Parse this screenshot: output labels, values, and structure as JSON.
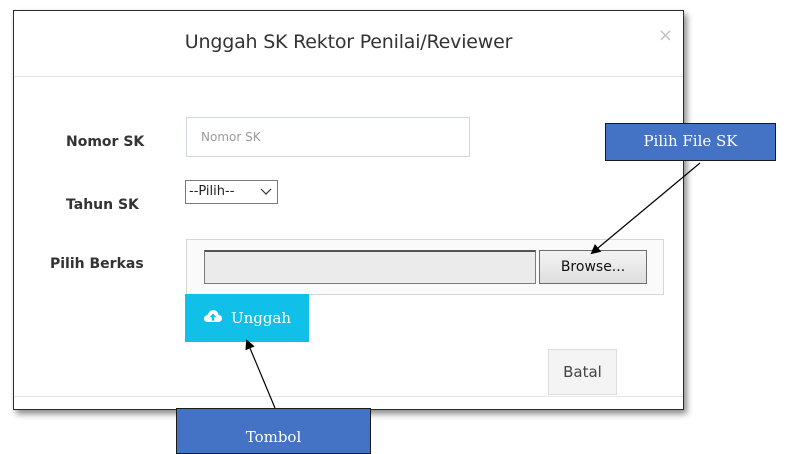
{
  "modal": {
    "title": "Unggah SK Rektor Penilai/Reviewer",
    "close_label": "×"
  },
  "form": {
    "nomor_label": "Nomor SK",
    "nomor_placeholder": "Nomor SK",
    "nomor_value": "",
    "tahun_label": "Tahun SK",
    "tahun_selected": "--Pilih--",
    "berkas_label": "Pilih Berkas",
    "file_path_value": "",
    "browse_label": "Browse..."
  },
  "buttons": {
    "upload_label": "Unggah",
    "upload_icon": "cloud-upload-icon",
    "cancel_label": "Batal"
  },
  "annotations": {
    "file_callout": "Pilih File SK",
    "button_callout": "Tombol"
  },
  "colors": {
    "upload_button": "#10c0e8",
    "callout_fill": "#4472c4"
  }
}
